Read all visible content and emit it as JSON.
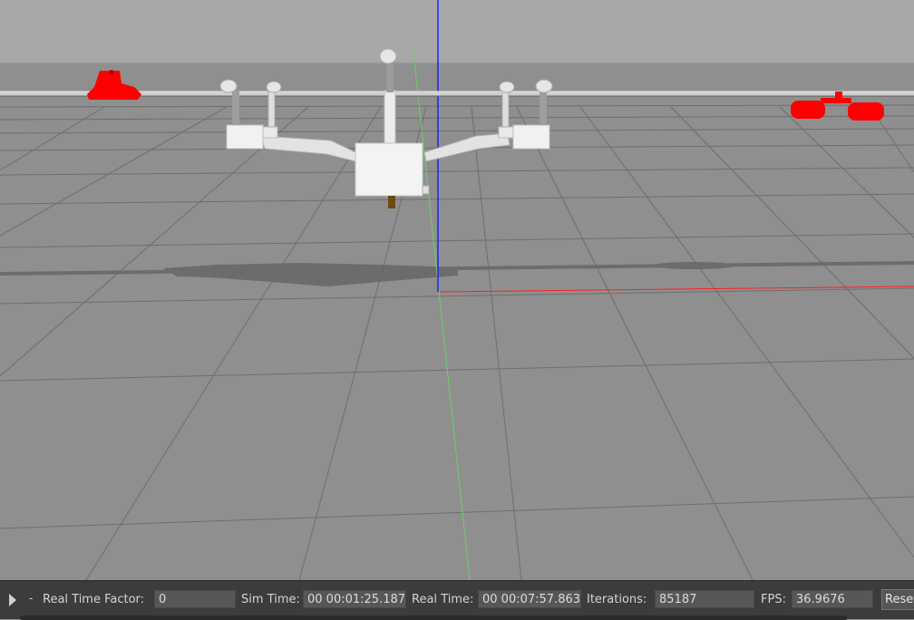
{
  "colors": {
    "sky": "#a8a8a8",
    "ground": "#8f8f8f",
    "grid": "#6f6f6f",
    "model_white": "#efefef",
    "marker_red": "#ff0000",
    "axis_x": "#ff2020",
    "axis_y": "#22cc22",
    "axis_z": "#1a1aff",
    "statusbar": "#3c3c3c"
  },
  "icons": {
    "play": "play-triangle-icon"
  },
  "statusbar": {
    "step_symbol": "-",
    "real_time_factor_label": "Real Time Factor:",
    "real_time_factor_value": "0",
    "sim_time_label": "Sim Time:",
    "sim_time_value": "00 00:01:25.187",
    "real_time_label": "Real Time:",
    "real_time_value": "00 00:07:57.863",
    "iterations_label": "Iterations:",
    "iterations_value": "85187",
    "fps_label": "FPS:",
    "fps_value": "36.9676",
    "reset_label": "Reset"
  }
}
